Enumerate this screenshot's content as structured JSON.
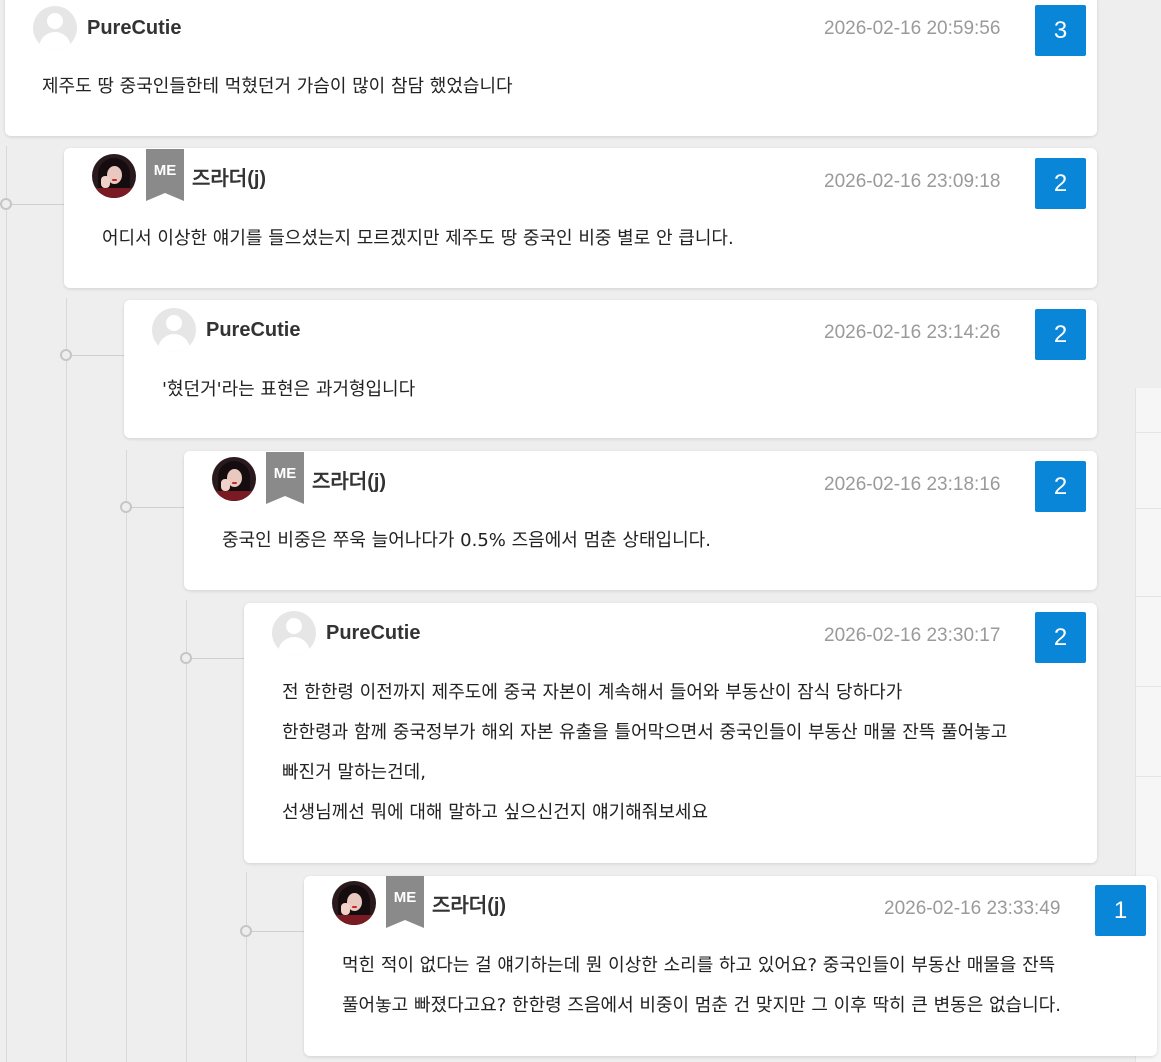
{
  "comments": [
    {
      "author": "PureCutie",
      "is_me": false,
      "timestamp": "2026-02-16 20:59:56",
      "count": "3",
      "lines": [
        "제주도 땅 중국인들한테 먹혔던거 가슴이 많이 참담 했었습니다"
      ]
    },
    {
      "author": "즈라더(j)",
      "is_me": true,
      "me_badge": "ME",
      "timestamp": "2026-02-16 23:09:18",
      "count": "2",
      "lines": [
        "어디서 이상한 얘기를 들으셨는지 모르겠지만 제주도 땅 중국인 비중 별로 안 큽니다."
      ]
    },
    {
      "author": "PureCutie",
      "is_me": false,
      "timestamp": "2026-02-16 23:14:26",
      "count": "2",
      "lines": [
        "'혔던거'라는 표현은 과거형입니다"
      ]
    },
    {
      "author": "즈라더(j)",
      "is_me": true,
      "me_badge": "ME",
      "timestamp": "2026-02-16 23:18:16",
      "count": "2",
      "lines": [
        "중국인 비중은 쭈욱 늘어나다가 0.5% 즈음에서 멈춘 상태입니다."
      ]
    },
    {
      "author": "PureCutie",
      "is_me": false,
      "timestamp": "2026-02-16 23:30:17",
      "count": "2",
      "lines": [
        "전 한한령 이전까지 제주도에 중국 자본이 계속해서 들어와 부동산이 잠식 당하다가",
        "한한령과 함께 중국정부가 해외 자본 유출을 틀어막으면서 중국인들이 부동산 매물 잔뜩 풀어놓고",
        "빠진거 말하는건데,",
        "선생님께선 뭐에 대해 말하고 싶으신건지 얘기해줘보세요"
      ]
    },
    {
      "author": "즈라더(j)",
      "is_me": true,
      "me_badge": "ME",
      "timestamp": "2026-02-16 23:33:49",
      "count": "1",
      "lines": [
        "먹힌 적이 없다는 걸 얘기하는데 뭔 이상한 소리를 하고 있어요? 중국인들이 부동산 매물을 잔뜩",
        "풀어놓고 빠졌다고요? 한한령 즈음에서 비중이 멈춘 건 맞지만 그 이후 딱히 큰 변동은 없습니다."
      ]
    }
  ],
  "colors": {
    "count_bg": "#0a86d8",
    "me_badge_bg": "#8a8a8a",
    "date_text": "#9a9a9a",
    "page_bg": "#eeeeee"
  },
  "icons": {
    "default_avatar": "user-silhouette-icon",
    "me_badge": "bookmark-badge-icon"
  }
}
